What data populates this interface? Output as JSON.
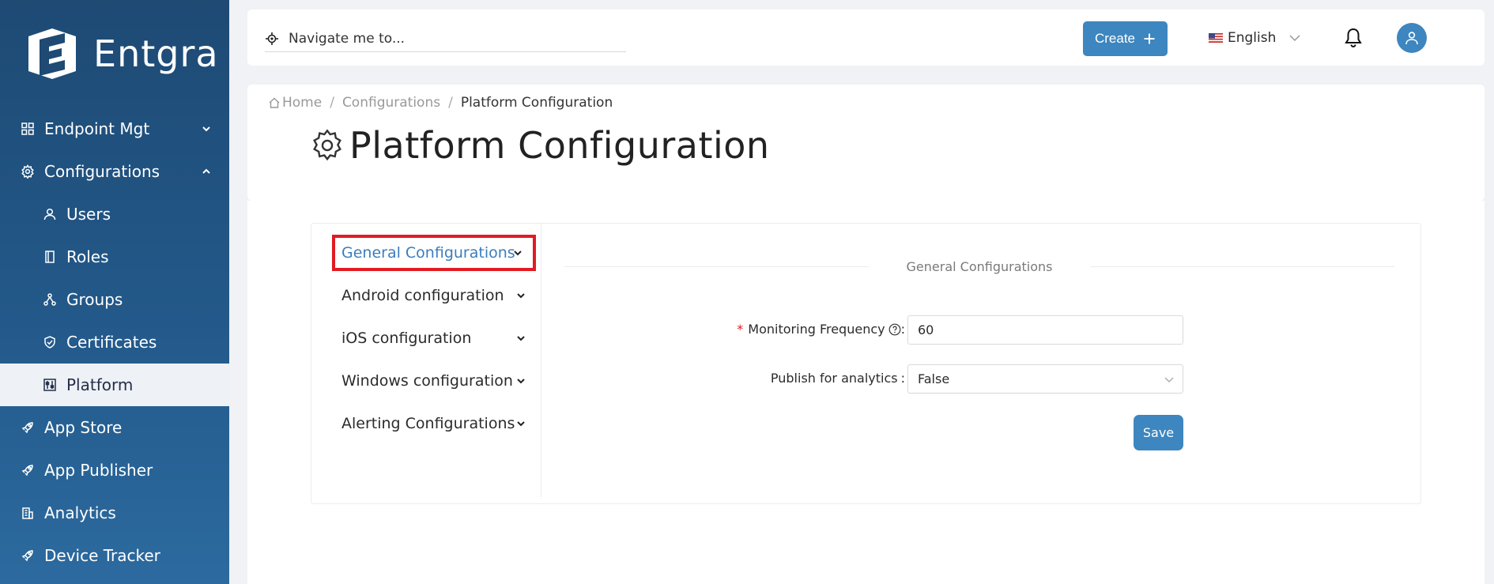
{
  "brand": {
    "name": "Entgra"
  },
  "sidebar": {
    "items": [
      {
        "label": "Endpoint Mgt",
        "icon": "grid-icon",
        "chevron": "down"
      },
      {
        "label": "Configurations",
        "icon": "gear-icon",
        "chevron": "up"
      },
      {
        "label": "Users",
        "icon": "user-icon"
      },
      {
        "label": "Roles",
        "icon": "book-icon"
      },
      {
        "label": "Groups",
        "icon": "nodes-icon"
      },
      {
        "label": "Certificates",
        "icon": "shield-icon"
      },
      {
        "label": "Platform",
        "icon": "sliders-icon",
        "active": true
      },
      {
        "label": "App Store",
        "icon": "rocket-icon"
      },
      {
        "label": "App Publisher",
        "icon": "rocket-icon"
      },
      {
        "label": "Analytics",
        "icon": "building-icon"
      },
      {
        "label": "Device Tracker",
        "icon": "rocket-icon"
      }
    ]
  },
  "header": {
    "navigate_placeholder": "Navigate me to...",
    "create_label": "Create",
    "language": "English"
  },
  "breadcrumb": {
    "home": "Home",
    "configurations": "Configurations",
    "current": "Platform Configuration"
  },
  "page": {
    "title": "Platform Configuration"
  },
  "config_menu": {
    "items": [
      {
        "label": "General Configurations",
        "selected": true
      },
      {
        "label": "Android configuration"
      },
      {
        "label": "iOS configuration"
      },
      {
        "label": "Windows configuration"
      },
      {
        "label": "Alerting Configurations"
      }
    ]
  },
  "form": {
    "section_title": "General Configurations",
    "monitoring_label": "Monitoring Frequency",
    "monitoring_value": "60",
    "publish_label": "Publish for analytics",
    "publish_value": "False",
    "save_label": "Save"
  },
  "colors": {
    "primary": "#3d86bf",
    "sidebar": "#23598a",
    "highlight": "#e11b22"
  }
}
